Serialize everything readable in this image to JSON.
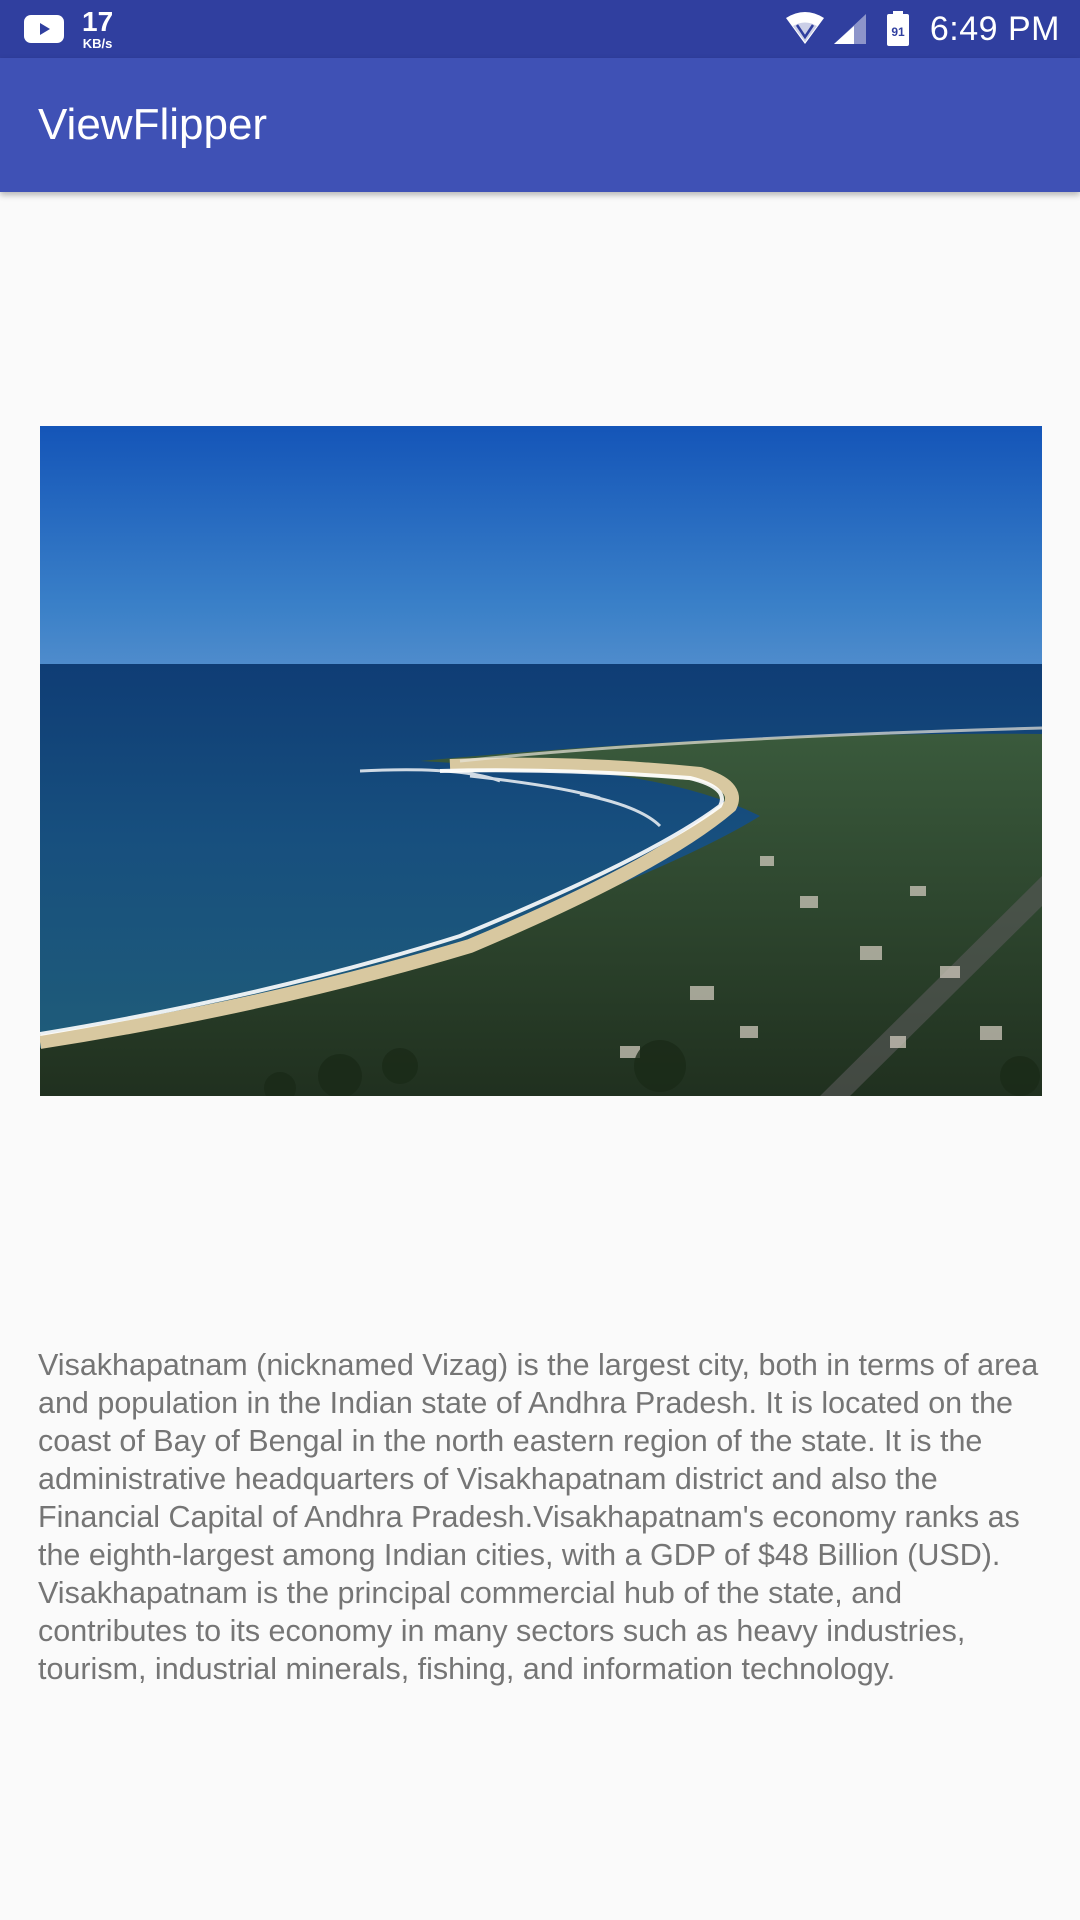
{
  "status_bar": {
    "net_speed_value": "17",
    "net_speed_unit": "KB/s",
    "battery_level": "91",
    "time": "6:49 PM",
    "icons": [
      "youtube-icon",
      "wifi-icon",
      "cell-signal-icon",
      "battery-icon"
    ]
  },
  "app_bar": {
    "title": "ViewFlipper",
    "color": "#3f51b5",
    "status_color": "#303f9f"
  },
  "flipper": {
    "image_subject": "aerial-coastline-photo"
  },
  "content": {
    "description": "Visakhapatnam (nicknamed Vizag) is the largest city, both in terms of area and population in the Indian state of Andhra Pradesh. It is located on the coast of Bay of Bengal in the north eastern region of the state. It is the administrative headquarters of Visakhapatnam district and also the Financial Capital of Andhra Pradesh.Visakhapatnam's economy ranks as the eighth-largest among Indian cities, with a GDP of $48 Billion (USD). Visakhapatnam is the principal commercial hub of the state, and contributes to its economy in many sectors such as heavy industries, tourism, industrial minerals, fishing, and information technology."
  }
}
